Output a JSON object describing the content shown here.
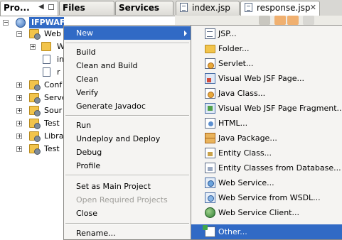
{
  "tabs": {
    "projects": "Pro...",
    "files": "Files",
    "services": "Services"
  },
  "editor_tabs": [
    {
      "label": "index.jsp"
    },
    {
      "label": "response.jsp"
    }
  ],
  "tree": {
    "project": "IFPWAFCAD",
    "rows": [
      {
        "label": "Web"
      },
      {
        "label": "W"
      },
      {
        "label": "in"
      },
      {
        "label": "r"
      },
      {
        "label": "Conf"
      },
      {
        "label": "Serve"
      },
      {
        "label": "Sour"
      },
      {
        "label": "Test"
      },
      {
        "label": "Libra"
      },
      {
        "label": "Test"
      }
    ]
  },
  "context_menu": {
    "items": [
      {
        "label": "New",
        "highlighted": true,
        "has_submenu": true
      },
      {
        "label": "Build"
      },
      {
        "label": "Clean and Build"
      },
      {
        "label": "Clean"
      },
      {
        "label": "Verify"
      },
      {
        "label": "Generate Javadoc"
      },
      {
        "label": "Run"
      },
      {
        "label": "Undeploy and Deploy"
      },
      {
        "label": "Debug"
      },
      {
        "label": "Profile"
      },
      {
        "label": "Set as Main Project"
      },
      {
        "label": "Open Required Projects",
        "disabled": true
      },
      {
        "label": "Close"
      },
      {
        "label": "Rename..."
      }
    ]
  },
  "submenu": {
    "items": [
      {
        "label": "JSP...",
        "icon": "jsp-icon"
      },
      {
        "label": "Folder...",
        "icon": "folder-icon"
      },
      {
        "label": "Servlet...",
        "icon": "servlet-icon"
      },
      {
        "label": "Visual Web JSF Page...",
        "icon": "visual-web-page-icon"
      },
      {
        "label": "Java Class...",
        "icon": "java-class-icon"
      },
      {
        "label": "Visual Web JSF Page Fragment...",
        "icon": "visual-web-fragment-icon"
      },
      {
        "label": "HTML...",
        "icon": "html-icon"
      },
      {
        "label": "Java Package...",
        "icon": "java-package-icon"
      },
      {
        "label": "Entity Class...",
        "icon": "entity-class-icon"
      },
      {
        "label": "Entity Classes from Database...",
        "icon": "entity-db-icon"
      },
      {
        "label": "Web Service...",
        "icon": "web-service-icon"
      },
      {
        "label": "Web Service from WSDL...",
        "icon": "wsdl-icon"
      },
      {
        "label": "Web Service Client...",
        "icon": "web-service-client-icon"
      },
      {
        "label": "Other...",
        "icon": "other-icon",
        "highlighted": true
      }
    ]
  },
  "colors": {
    "selection": "#316ac5",
    "menu_bg": "#f5f4f2",
    "tab_bg": "#d8d7d3"
  }
}
